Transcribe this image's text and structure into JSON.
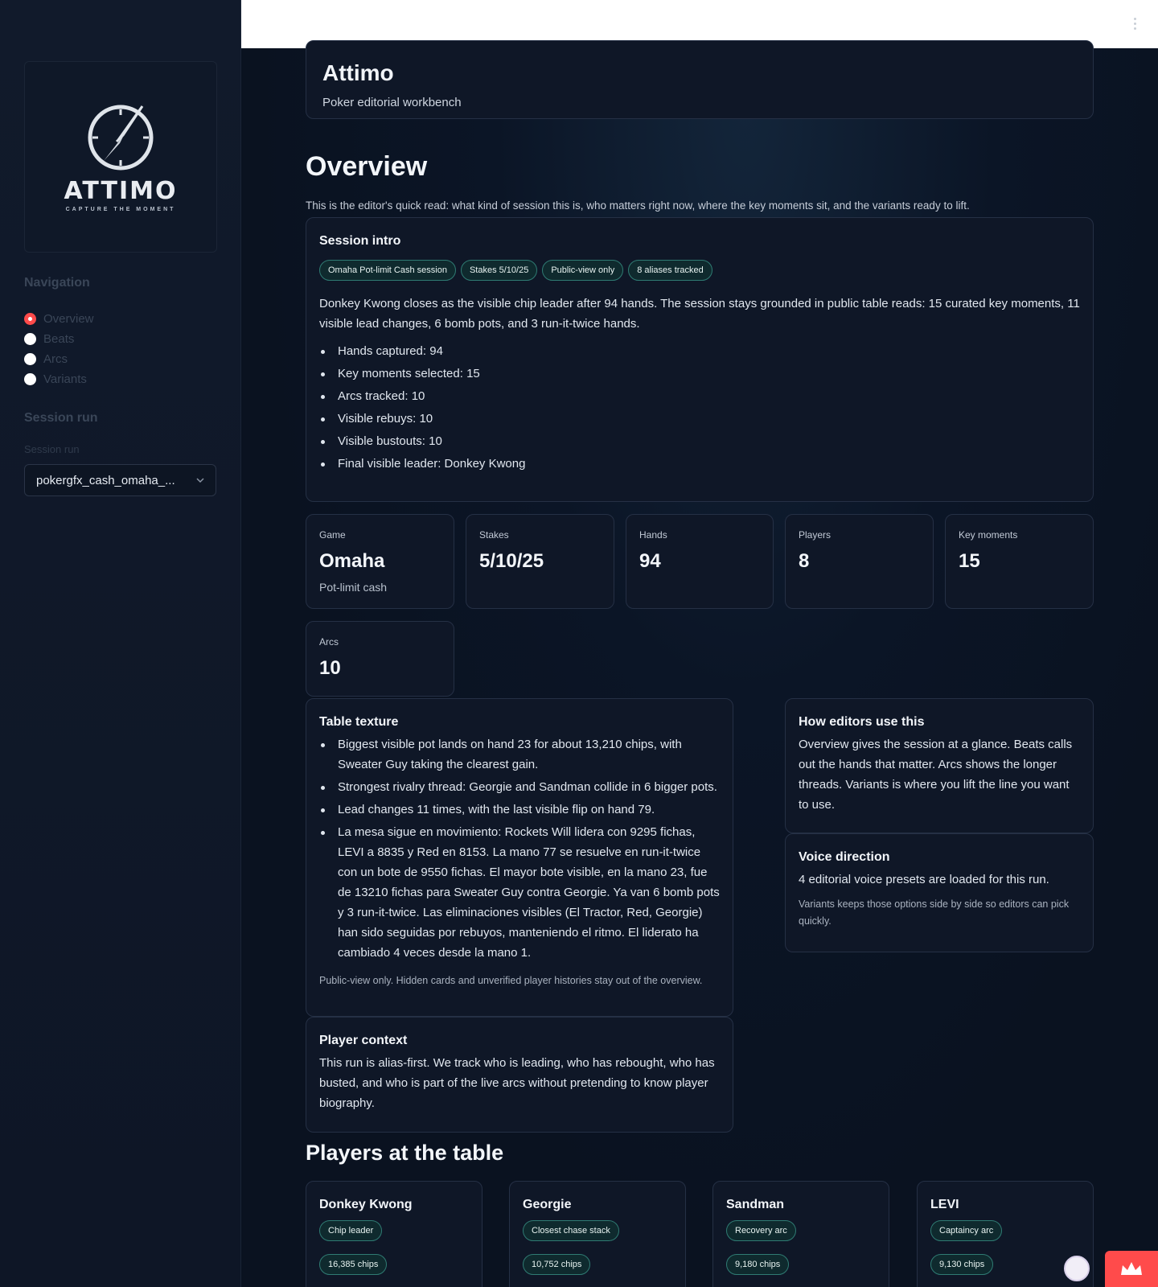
{
  "sidebar": {
    "logo": {
      "word": "ATTIMO",
      "tagline": "CAPTURE THE MOMENT"
    },
    "nav_heading": "Navigation",
    "nav_items": [
      "Overview",
      "Beats",
      "Arcs",
      "Variants"
    ],
    "nav_selected": "Overview",
    "session_heading": "Session run",
    "select_label": "Session run",
    "select_value": "pokergfx_cash_omaha_..."
  },
  "hero": {
    "title": "Attimo",
    "subtitle": "Poker editorial workbench"
  },
  "overview": {
    "title": "Overview",
    "lead": "This is the editor's quick read: what kind of session this is, who matters right now, where the key moments sit, and the variants ready to lift."
  },
  "session_intro": {
    "title": "Session intro",
    "pills": [
      "Omaha Pot-limit Cash session",
      "Stakes 5/10/25",
      "Public-view only",
      "8 aliases tracked"
    ],
    "summary": "Donkey Kwong closes as the visible chip leader after 94 hands. The session stays grounded in public table reads: 15 curated key moments, 11 visible lead changes, 6 bomb pots, and 3 run-it-twice hands.",
    "bullets": [
      "Hands captured: 94",
      "Key moments selected: 15",
      "Arcs tracked: 10",
      "Visible rebuys: 10",
      "Visible bustouts: 10",
      "Final visible leader: Donkey Kwong"
    ]
  },
  "metrics": [
    {
      "label": "Game",
      "value": "Omaha",
      "sub": "Pot-limit cash"
    },
    {
      "label": "Stakes",
      "value": "5/10/25",
      "sub": ""
    },
    {
      "label": "Hands",
      "value": "94",
      "sub": ""
    },
    {
      "label": "Players",
      "value": "8",
      "sub": ""
    },
    {
      "label": "Key moments",
      "value": "15",
      "sub": ""
    },
    {
      "label": "Arcs",
      "value": "10",
      "sub": ""
    }
  ],
  "table_texture": {
    "title": "Table texture",
    "bullets": [
      "Biggest visible pot lands on hand 23 for about 13,210 chips, with Sweater Guy taking the clearest gain.",
      "Strongest rivalry thread: Georgie and Sandman collide in 6 bigger pots.",
      "Lead changes 11 times, with the last visible flip on hand 79.",
      "La mesa sigue en movimiento: Rockets Will lidera con 9295 fichas, LEVI a 8835 y Red en 8153. La mano 77 se resuelve en run-it-twice con un bote de 9550 fichas. El mayor bote visible, en la mano 23, fue de 13210 fichas para Sweater Guy contra Georgie. Ya van 6 bomb pots y 3 run-it-twice. Las eliminaciones visibles (El Tractor, Red, Georgie) han sido seguidas por rebuyos, manteniendo el ritmo. El liderato ha cambiado 4 veces desde la mano 1."
    ],
    "note": "Public-view only. Hidden cards and unverified player histories stay out of the overview."
  },
  "how_editors": {
    "title": "How editors use this",
    "text": "Overview gives the session at a glance. Beats calls out the hands that matter. Arcs shows the longer threads. Variants is where you lift the line you want to use."
  },
  "voice": {
    "title": "Voice direction",
    "text": "4 editorial voice presets are loaded for this run.",
    "note": "Variants keeps those options side by side so editors can pick quickly."
  },
  "player_context": {
    "title": "Player context",
    "text": "This run is alias-first. We track who is leading, who has rebought, who has busted, and who is part of the live arcs without pretending to know player biography."
  },
  "players_section": {
    "title": "Players at the table",
    "players": [
      {
        "name": "Donkey Kwong",
        "role": "Chip leader",
        "chips": "16,385 chips"
      },
      {
        "name": "Georgie",
        "role": "Closest chase stack",
        "chips": "10,752 chips"
      },
      {
        "name": "Sandman",
        "role": "Recovery arc",
        "chips": "9,180 chips"
      },
      {
        "name": "LEVI",
        "role": "Captaincy arc",
        "chips": "9,130 chips"
      }
    ]
  },
  "colors": {
    "accent": "#ff4b4b",
    "pill_border": "#2f7b73",
    "card_bg": "#0f1727"
  }
}
